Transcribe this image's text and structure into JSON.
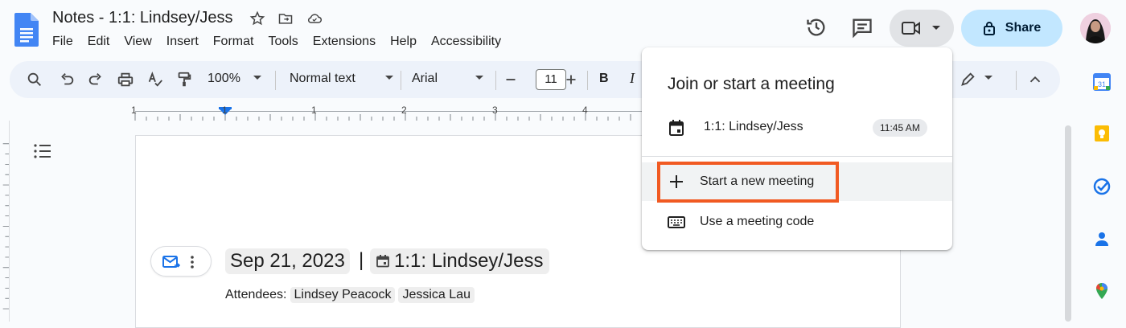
{
  "document": {
    "title": "Notes - 1:1: Lindsey/Jess"
  },
  "menu": [
    "File",
    "Edit",
    "View",
    "Insert",
    "Format",
    "Tools",
    "Extensions",
    "Help",
    "Accessibility"
  ],
  "header": {
    "share_label": "Share"
  },
  "toolbar": {
    "zoom": "100%",
    "style": "Normal text",
    "font": "Arial",
    "font_size": "11",
    "bold": "B",
    "italic": "I"
  },
  "ruler": {
    "marks": [
      "1",
      "1",
      "1",
      "2",
      "3",
      "4"
    ]
  },
  "content": {
    "date_chip": "Sep 21, 2023",
    "separator": "|",
    "event_chip": "1:1: Lindsey/Jess",
    "attendees_label": "Attendees:",
    "attendees": [
      "Lindsey Peacock",
      "Jessica Lau"
    ]
  },
  "meeting_menu": {
    "title": "Join or start a meeting",
    "event_label": "1:1: Lindsey/Jess",
    "event_time": "11:45 AM",
    "start_label": "Start a new meeting",
    "code_label": "Use a meeting code"
  },
  "colors": {
    "highlight": "#f15a22",
    "share_bg": "#c2e7ff",
    "doc_blue": "#4285f4"
  }
}
